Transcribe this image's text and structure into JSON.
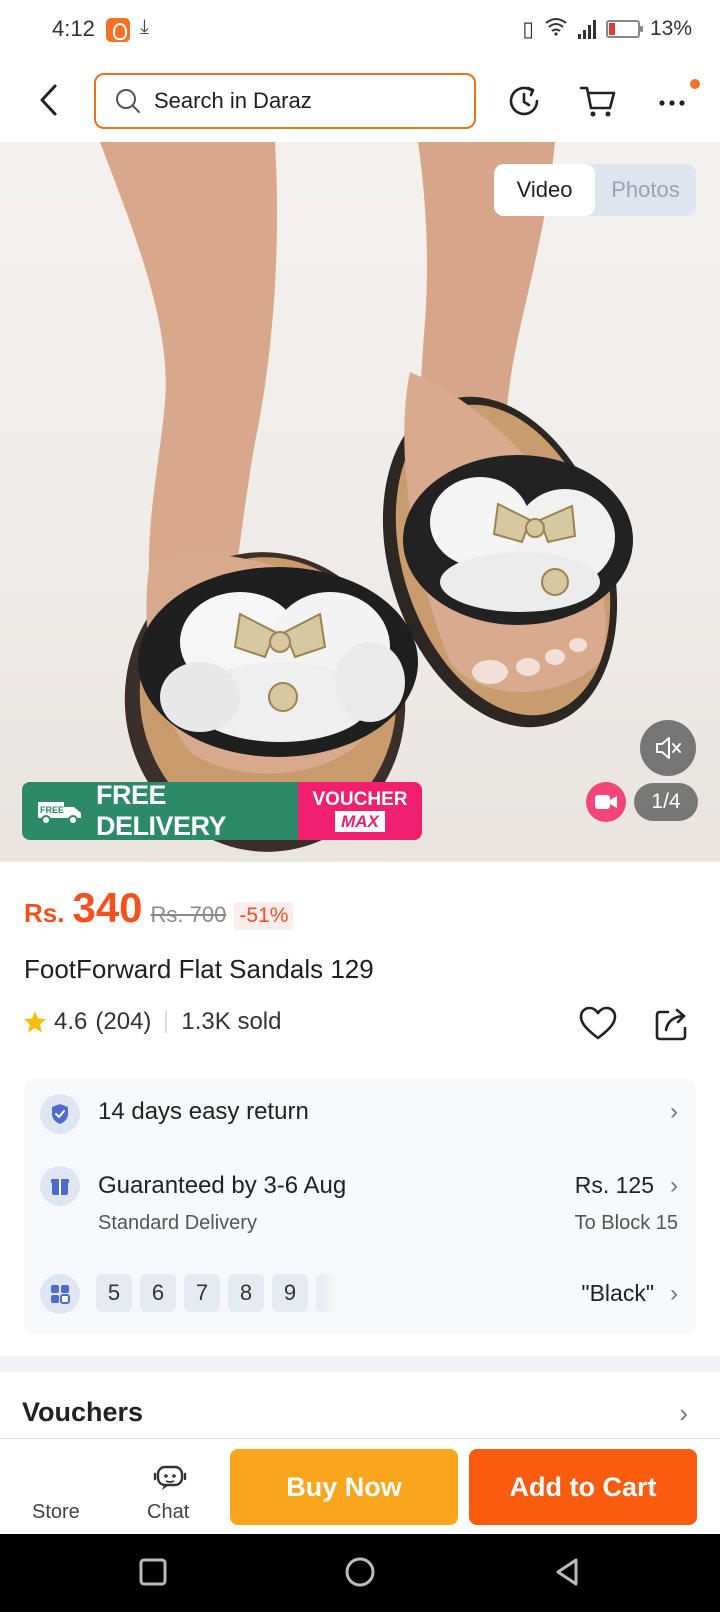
{
  "status_bar": {
    "time": "4:12",
    "battery": "13%"
  },
  "header": {
    "search_placeholder": "Search in Daraz"
  },
  "gallery": {
    "tabs": [
      "Video",
      "Photos"
    ],
    "active_tab": "Video",
    "counter": "1/4",
    "promo": {
      "free_tag": "FREE",
      "free_delivery": "FREE DELIVERY",
      "voucher_top": "VOUCHER",
      "voucher_bottom": "MAX"
    }
  },
  "product": {
    "currency": "Rs.",
    "price": "340",
    "original_price": "Rs. 700",
    "discount": "-51%",
    "title": "FootForward Flat Sandals 129",
    "rating": "4.6",
    "rating_count": "(204)",
    "sold": "1.3K sold"
  },
  "info": {
    "returns": "14 days easy return",
    "delivery_title": "Guaranteed by 3-6 Aug",
    "delivery_type": "Standard Delivery",
    "delivery_fee": "Rs. 125",
    "delivery_location": "To Block 15",
    "sizes": [
      "5",
      "6",
      "7",
      "8",
      "9"
    ],
    "selected_color": "\"Black\""
  },
  "sections": {
    "vouchers": "Vouchers"
  },
  "action_bar": {
    "store": "Store",
    "chat": "Chat",
    "buy_now": "Buy Now",
    "add_to_cart": "Add to Cart"
  },
  "colors": {
    "brand_orange": "#f57224",
    "buy_now": "#f9a51d",
    "add_to_cart": "#fa5c0f",
    "price": "#f4511e",
    "free_delivery": "#2c8a68",
    "voucher": "#f0206e"
  }
}
